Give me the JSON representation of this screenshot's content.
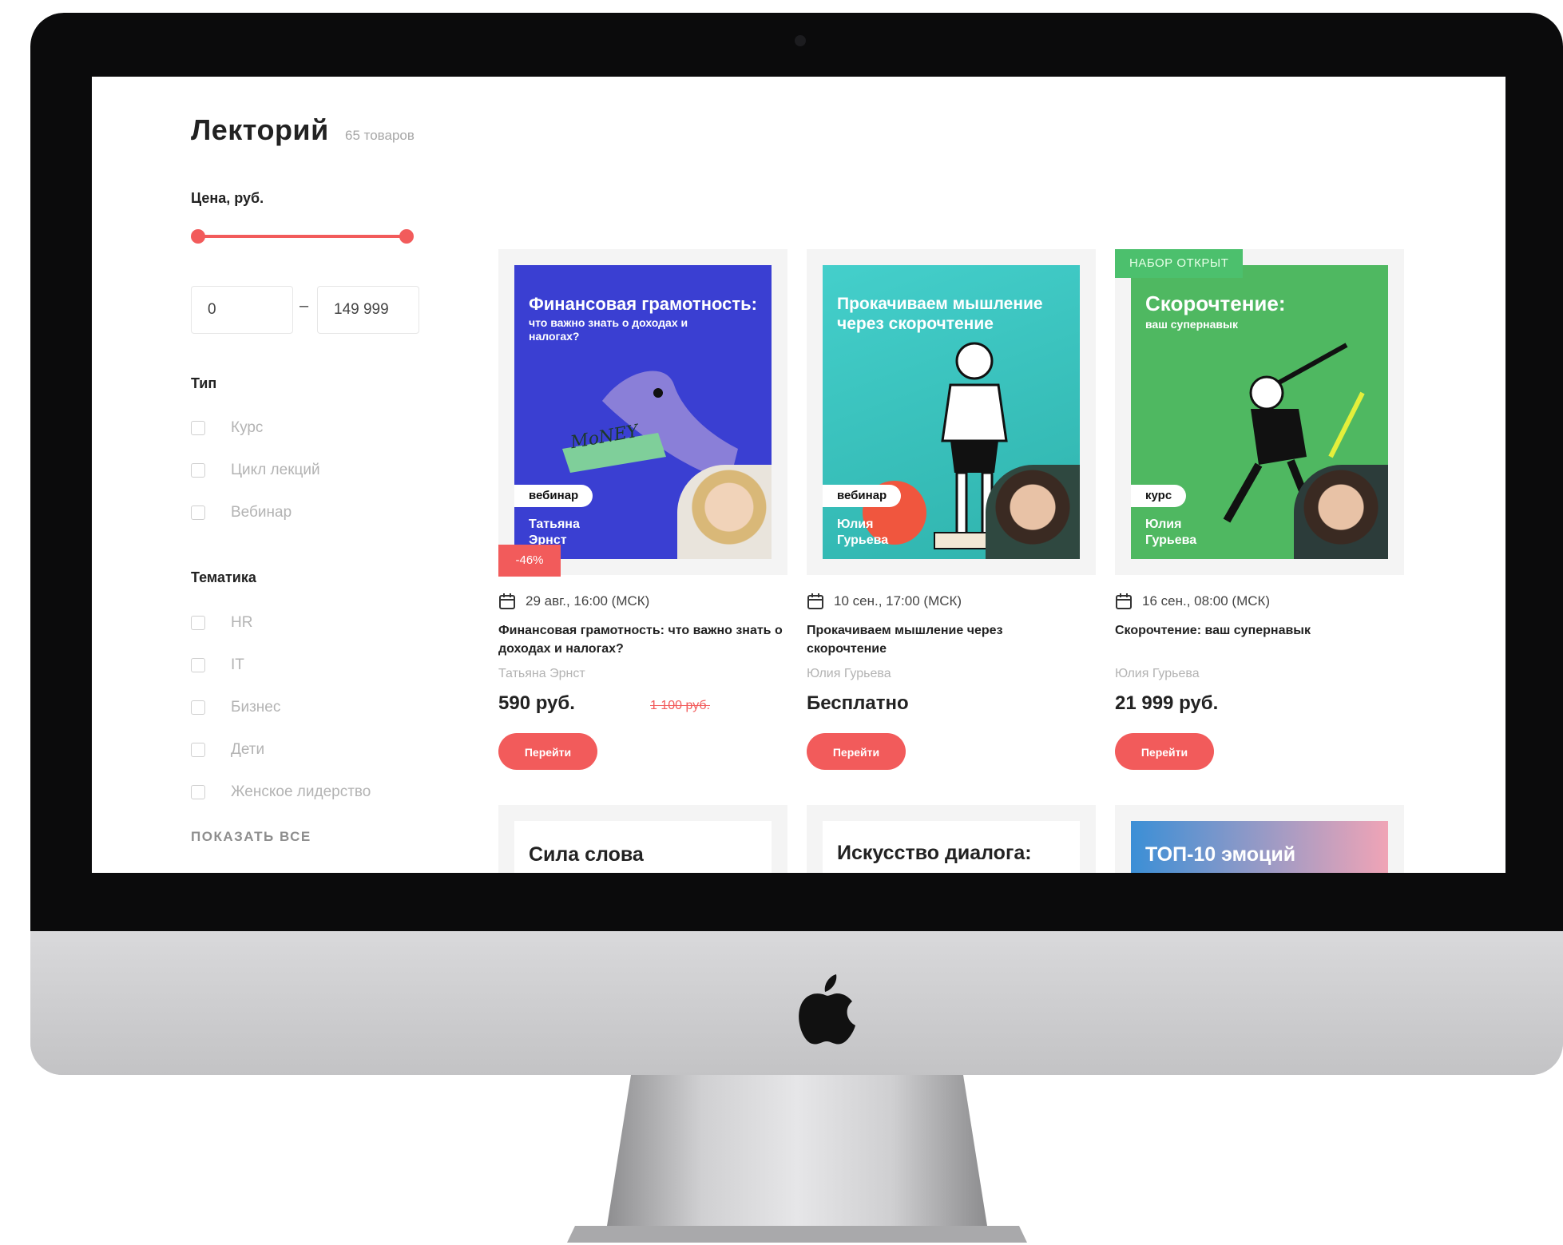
{
  "header": {
    "title": "Лекторий",
    "count": "65 товаров"
  },
  "filters": {
    "price_heading": "Цена, руб.",
    "price_min": "0",
    "price_max": "149 999",
    "price_dash": "–",
    "type_heading": "Тип",
    "types": [
      "Курс",
      "Цикл лекций",
      "Вебинар"
    ],
    "topic_heading": "Тематика",
    "topics": [
      "HR",
      "IT",
      "Бизнес",
      "Дети",
      "Женское лидерство"
    ],
    "show_all": "ПОКАЗАТЬ ВСЕ"
  },
  "cards": [
    {
      "cover_title": "Финансовая грамотность:",
      "cover_subtitle": "что важно знать о доходах и налогах?",
      "cover_word": "MoNEY",
      "format": "вебинар",
      "cover_author": "Татьяна Эрнст",
      "discount": "-46%",
      "date": "29 авг., 16:00 (МСК)",
      "name": "Финансовая грамотность: что важно знать о доходах и налогах?",
      "author": "Татьяна Эрнст",
      "price": "590 руб.",
      "old_price": "1 100 руб.",
      "button": "Перейти",
      "colors": {
        "cover": "#3a3fd2"
      }
    },
    {
      "cover_title": "Прокачиваем мышление через скорочтение",
      "format": "вебинар",
      "cover_author": "Юлия Гурьева",
      "date": "10 сен., 17:00 (МСК)",
      "name": "Прокачиваем мышление через скорочтение",
      "author": "Юлия Гурьева",
      "price": "Бесплатно",
      "button": "Перейти",
      "colors": {
        "cover": "#3cc4c1"
      }
    },
    {
      "ribbon": "НАБОР ОТКРЫТ",
      "cover_title": "Скорочтение:",
      "cover_subtitle": "ваш супернавык",
      "format": "курс",
      "cover_author": "Юлия Гурьева",
      "date": "16 сен., 08:00 (МСК)",
      "name": "Скорочтение: ваш супернавык",
      "author": "Юлия Гурьева",
      "price": "21 999 руб.",
      "button": "Перейти",
      "colors": {
        "cover": "#4fb861"
      }
    }
  ],
  "next_row": [
    "Сила слова",
    "Искусство диалога:",
    "ТОП-10 эмоций"
  ],
  "colors": {
    "accent": "#f25b5b",
    "bezel": "#0b0b0c",
    "chin": "#d4d4d4"
  },
  "icons": [
    "calendar-icon",
    "apple-logo-icon"
  ]
}
